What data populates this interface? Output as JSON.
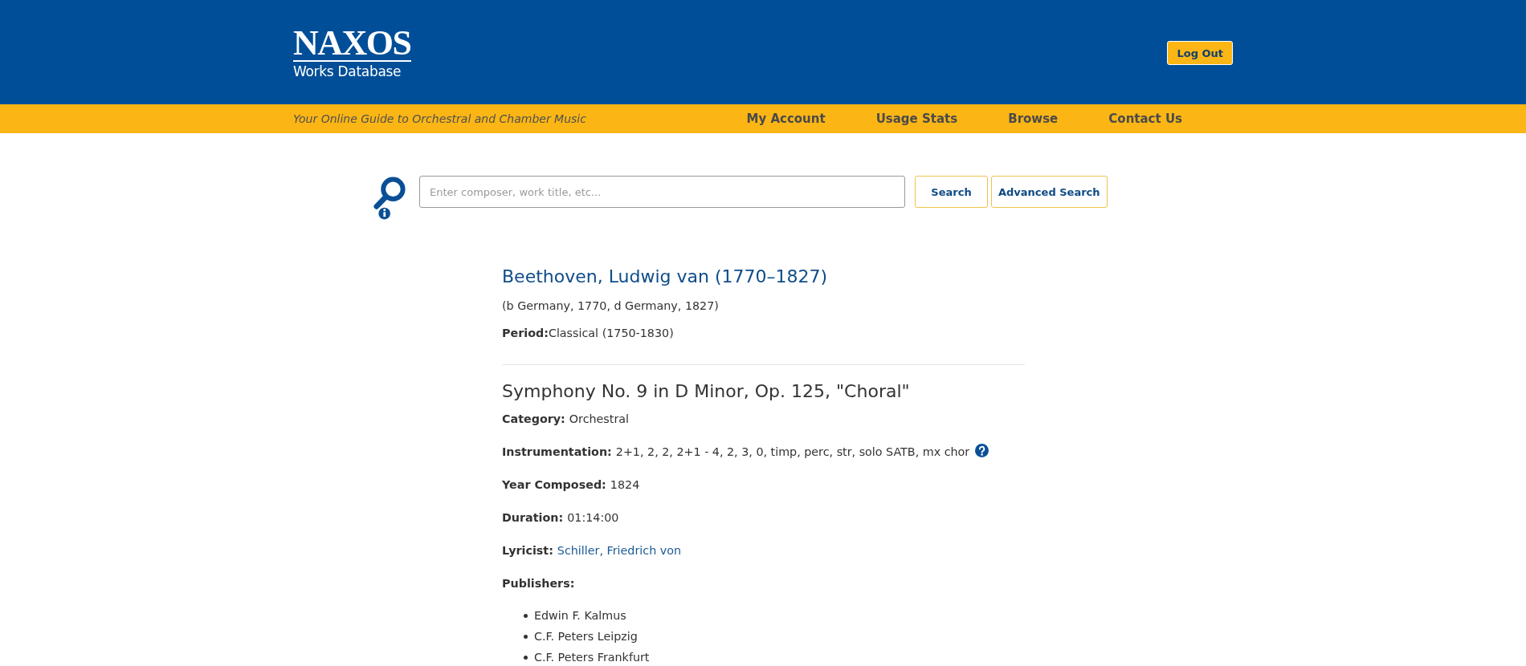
{
  "header": {
    "logo": {
      "wordmark": "NAXOS",
      "subtitle": "Works Database"
    },
    "logout_button": "Log Out"
  },
  "nav_bar": {
    "tagline": "Your Online Guide to Orchestral and Chamber Music",
    "items": [
      "My Account",
      "Usage Stats",
      "Browse",
      "Contact Us"
    ]
  },
  "search": {
    "placeholder": "Enter composer, work title, etc...",
    "buttons": [
      "Search",
      "Advanced Search"
    ]
  },
  "composer": {
    "name": "Beethoven, Ludwig van (1770–1827)",
    "origin": "(b Germany, 1770, d Germany, 1827)",
    "period": {
      "label": "Period:",
      "value": "Classical (1750-1830)"
    }
  },
  "work": {
    "title": "Symphony No. 9 in D Minor, Op. 125, \"Choral\"",
    "fields": [
      {
        "kind": "text",
        "label": "Category:",
        "value": "Orchestral"
      },
      {
        "kind": "help",
        "label": "Instrumentation:",
        "value": "2+1, 2, 2, 2+1 - 4, 2, 3, 0, timp, perc, str, solo SATB, mx chor"
      },
      {
        "kind": "text",
        "label": "Year Composed:",
        "value": "1824"
      },
      {
        "kind": "text",
        "label": "Duration:",
        "value": "01:14:00"
      },
      {
        "kind": "link",
        "label": "Lyricist:",
        "value": "Schiller, Friedrich von"
      }
    ],
    "publishers": {
      "label": "Publishers:",
      "items": [
        "Edwin F. Kalmus",
        "C.F. Peters Leipzig",
        "C.F. Peters Frankfurt"
      ]
    }
  }
}
